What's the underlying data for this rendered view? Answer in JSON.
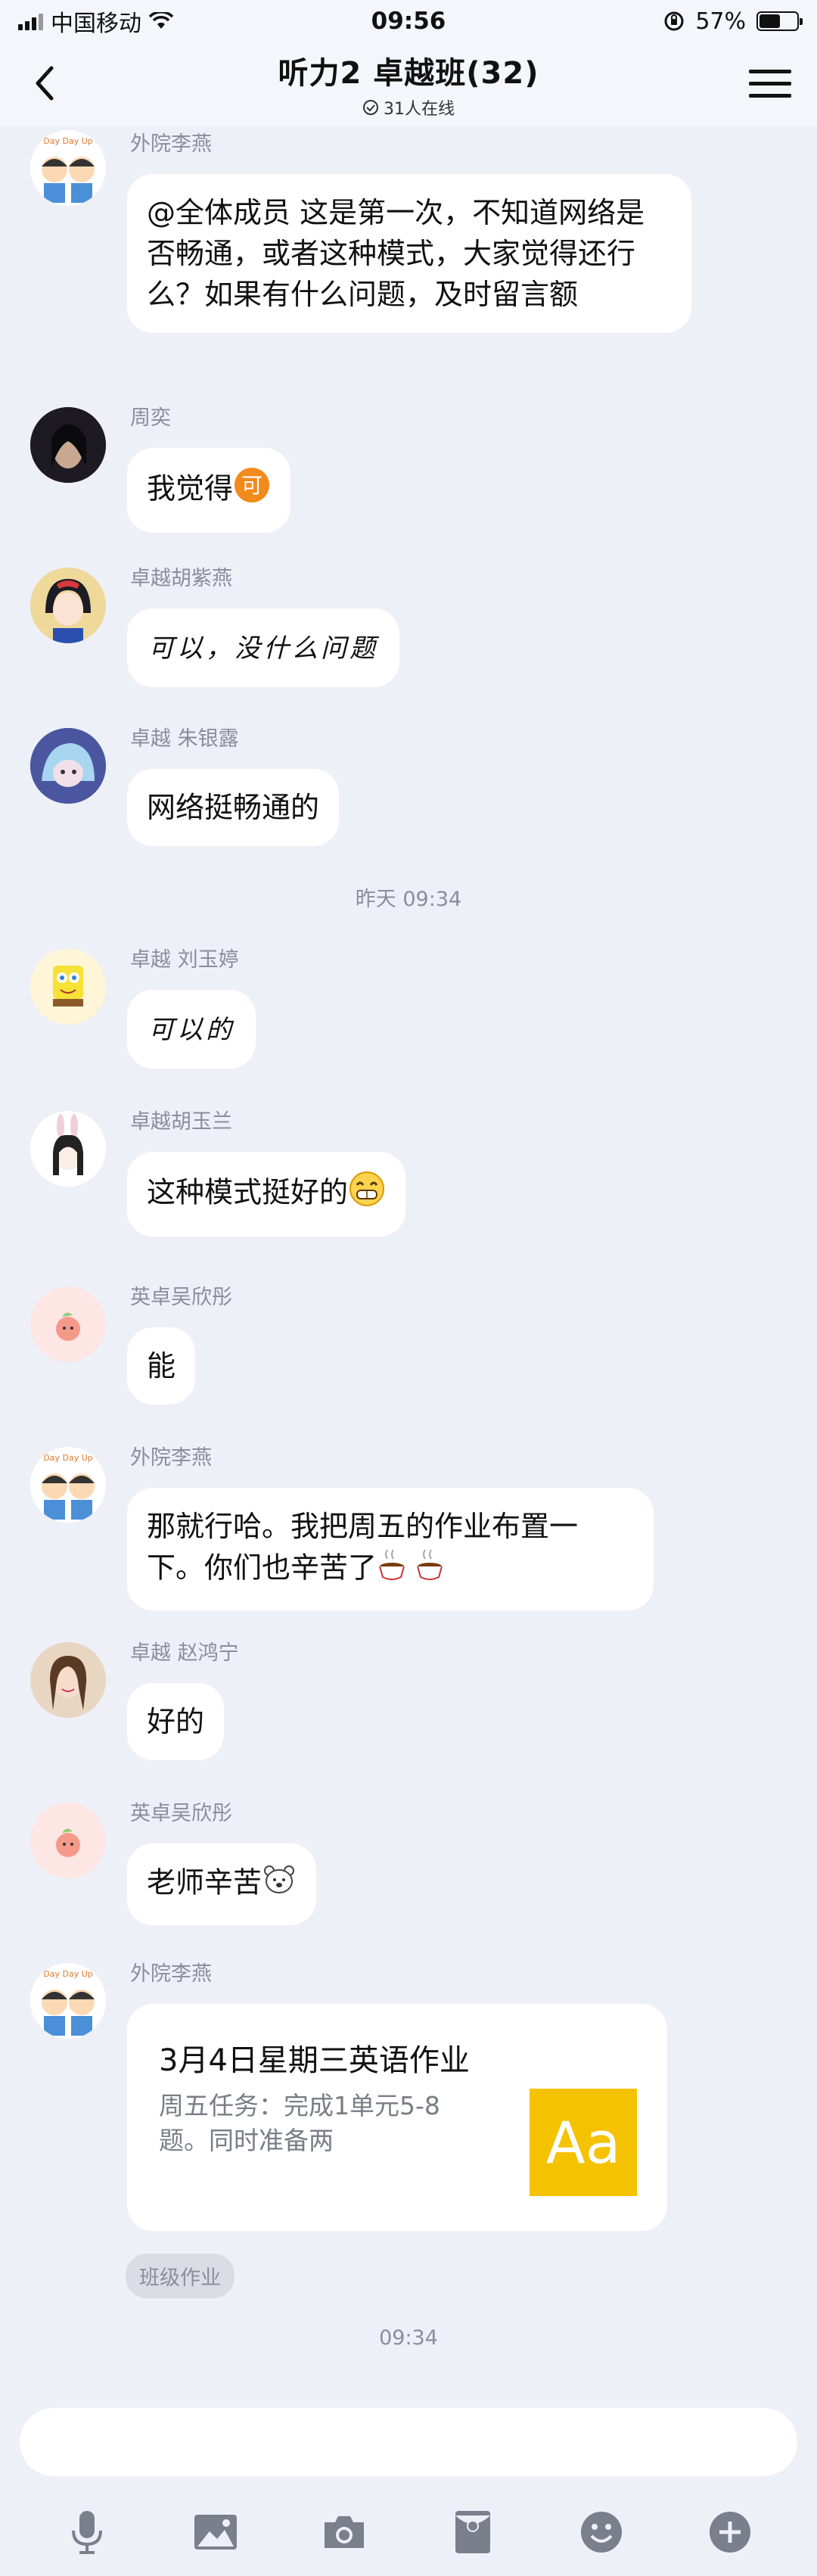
{
  "status_bar": {
    "carrier": "中国移动",
    "time": "09:56",
    "battery": "57%",
    "battery_level": 0.57
  },
  "header": {
    "title": "听力2 卓越班(32)",
    "online": "31人在线"
  },
  "messages": [
    {
      "sender": "外院李燕",
      "text": "@全体成员 这是第一次，不知道网络是否畅通，或者这种模式，大家觉得还行么？如果有什么问题，及时留言额",
      "avatar": "daydayup-avatar"
    },
    {
      "sender": "周奕",
      "text": "我觉得",
      "emoji": "可",
      "avatar": "portrait-avatar"
    },
    {
      "sender": "卓越胡紫燕",
      "text": "可以，没什么问题",
      "avatar": "snow-white-avatar"
    },
    {
      "sender": "卓越 朱银露",
      "text": "网络挺畅通的",
      "avatar": "anime-avatar"
    },
    {
      "sender": "卓越 刘玉婷",
      "text": "可以的",
      "avatar": "spongebob-avatar"
    },
    {
      "sender": "卓越胡玉兰",
      "text": "这种模式挺好的",
      "avatar": "bunny-girl-avatar"
    },
    {
      "sender": "英卓吴欣彤",
      "text": "能",
      "avatar": "peach-avatar"
    },
    {
      "sender": "外院李燕",
      "text": "那就行哈。我把周五的作业布置一下。你们也辛苦了",
      "avatar": "daydayup-avatar"
    },
    {
      "sender": "卓越 赵鸿宁",
      "text": "好的",
      "avatar": "photo-avatar"
    },
    {
      "sender": "英卓吴欣彤",
      "text": "老师辛苦",
      "avatar": "peach-avatar"
    },
    {
      "sender": "外院李燕",
      "avatar": "daydayup-avatar"
    }
  ],
  "time_separators": [
    "昨天 09:34",
    "09:34"
  ],
  "homework_card": {
    "title": "3月4日星期三英语作业",
    "desc": "周五任务：完成1单元5-8题。同时准备两",
    "icon_text": "Aa",
    "tag": "班级作业"
  },
  "avatar_labels": {
    "daydayup": "Day Day Up"
  },
  "colors": {
    "background": "#eef0f7",
    "bubble": "#ffffff",
    "homework_icon": "#f5c200",
    "muted_text": "#8b8e98"
  }
}
